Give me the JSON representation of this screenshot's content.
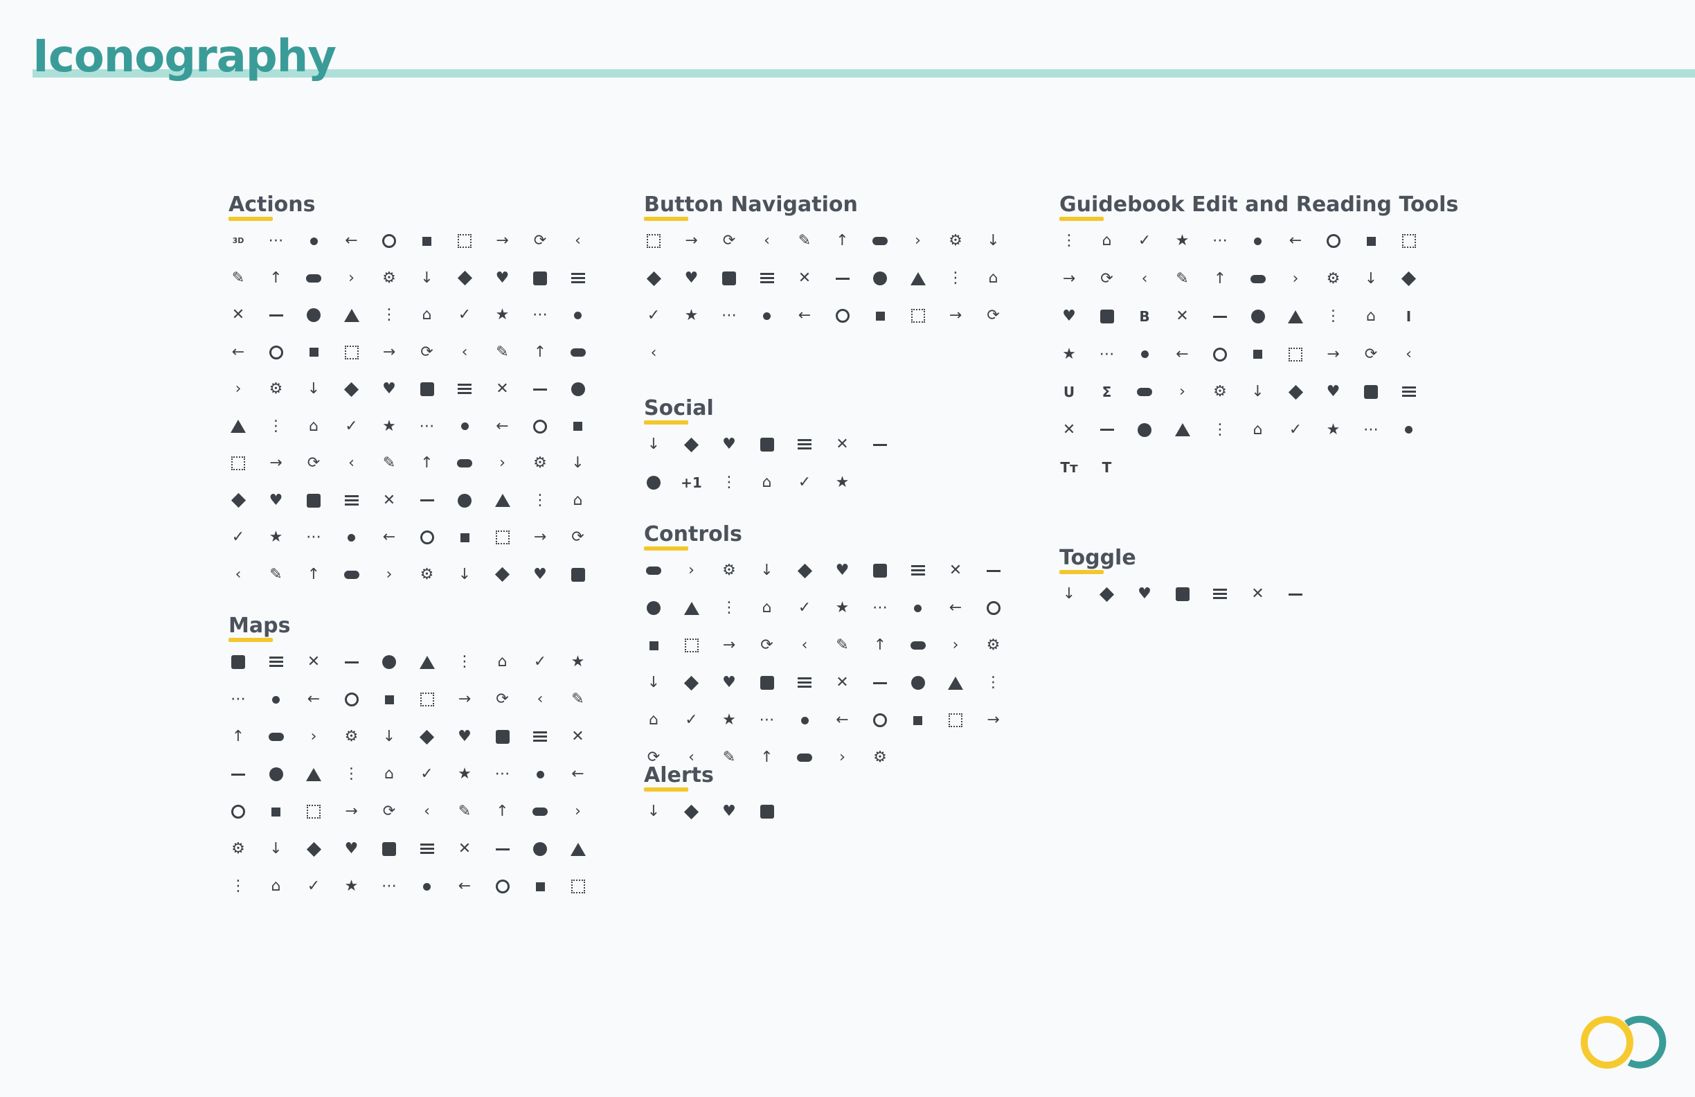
{
  "title": "Iconography",
  "colors": {
    "title": "#3a9c98",
    "title_rule": "#aee0d9",
    "section_underline": "#f3c72b",
    "icon": "#3c4148",
    "logo_yellow": "#f6ca2e",
    "logo_teal": "#3a9c98"
  },
  "sections": {
    "actions": {
      "title": "Actions",
      "count": 100
    },
    "maps": {
      "title": "Maps",
      "count": 70
    },
    "button_navigation": {
      "title": "Button Navigation",
      "count": 31
    },
    "social": {
      "title": "Social",
      "count": 13
    },
    "controls": {
      "title": "Controls",
      "count": 57
    },
    "alerts": {
      "title": "Alerts",
      "count": 4
    },
    "guidebook": {
      "title": "Guidebook Edit and Reading Tools",
      "count": 62
    },
    "toggle": {
      "title": "Toggle",
      "count": 7
    }
  },
  "text_icons": {
    "social_plus_one": "+1",
    "format_bold": "B",
    "format_underline": "U",
    "format_italic": "I",
    "format_sum": "Σ",
    "text_size_small": "Tт",
    "text_size_large": "T",
    "action_3d": "3D"
  }
}
